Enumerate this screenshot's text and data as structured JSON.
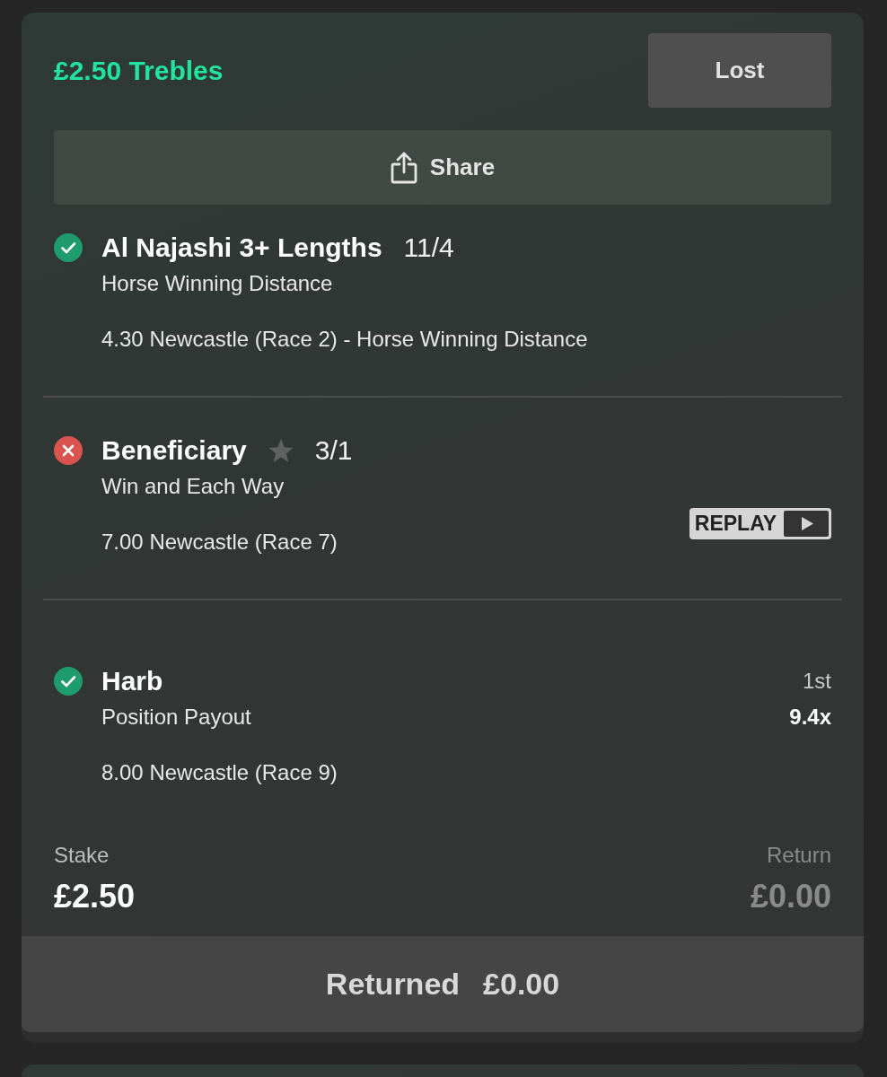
{
  "bet": {
    "title": "£2.50 Trebles",
    "status": "Lost",
    "share_label": "Share"
  },
  "selections": [
    {
      "won": true,
      "name": "Al Najashi 3+ Lengths",
      "starred": false,
      "odds": "11/4",
      "market": "Horse Winning Distance",
      "event": "4.30 Newcastle (Race 2) - Horse Winning Distance"
    },
    {
      "won": false,
      "name": "Beneficiary",
      "starred": true,
      "odds": "3/1",
      "market": "Win and Each Way",
      "event": "7.00 Newcastle (Race 7)",
      "replay_label": "REPLAY"
    },
    {
      "won": true,
      "name": "Harb",
      "starred": false,
      "market": "Position Payout",
      "event": "8.00 Newcastle (Race 9)",
      "position": "1st",
      "payout": "9.4x"
    }
  ],
  "stake": {
    "label": "Stake",
    "value": "£2.50"
  },
  "return": {
    "label": "Return",
    "value": "£0.00"
  },
  "returned": {
    "label": "Returned",
    "value": "£0.00"
  }
}
